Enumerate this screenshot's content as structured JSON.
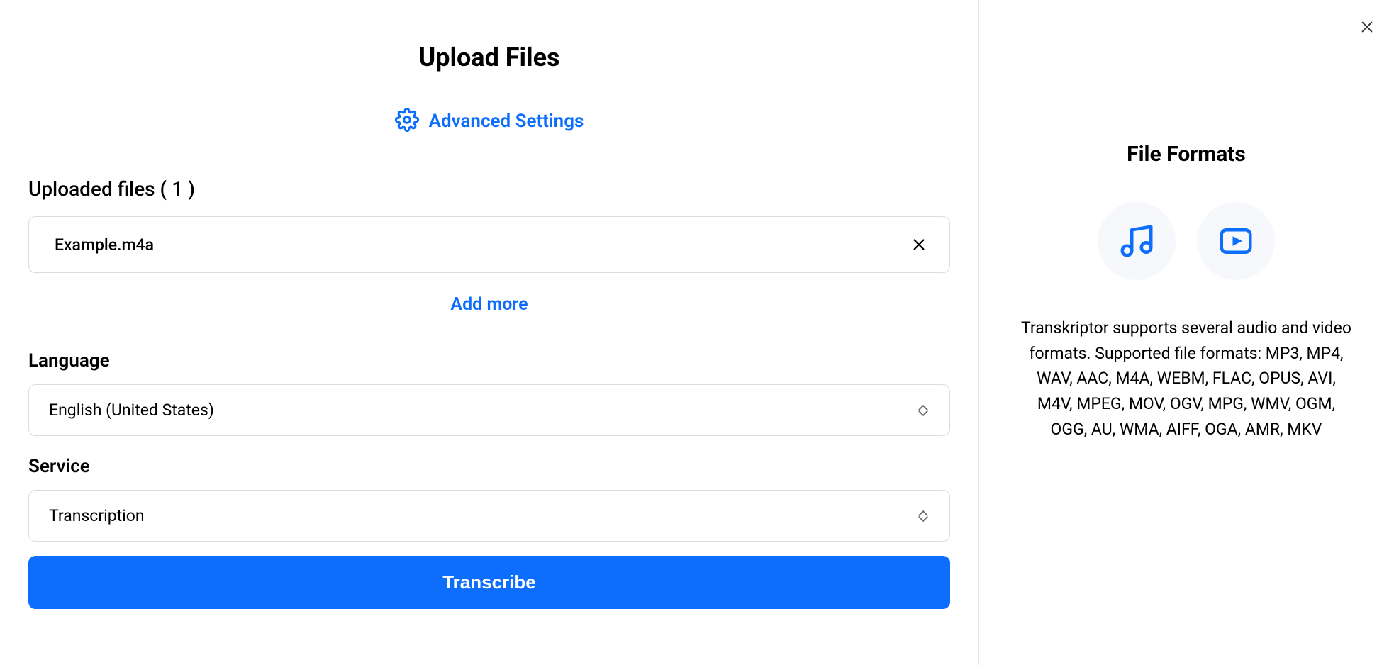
{
  "header": {
    "title": "Upload Files",
    "advanced_settings_label": "Advanced Settings"
  },
  "uploaded": {
    "heading": "Uploaded files ( 1 )",
    "files": [
      {
        "name": "Example.m4a"
      }
    ],
    "add_more_label": "Add more"
  },
  "language": {
    "label": "Language",
    "selected": "English (United States)"
  },
  "service": {
    "label": "Service",
    "selected": "Transcription"
  },
  "action": {
    "transcribe_label": "Transcribe"
  },
  "sidebar": {
    "title": "File Formats",
    "description": "Transkriptor supports several audio and video formats. Supported file formats: MP3, MP4, WAV, AAC, M4A, WEBM, FLAC, OPUS, AVI, M4V, MPEG, MOV, OGV, MPG, WMV, OGM, OGG, AU, WMA, AIFF, OGA, AMR, MKV"
  },
  "colors": {
    "accent": "#0d6efd"
  }
}
